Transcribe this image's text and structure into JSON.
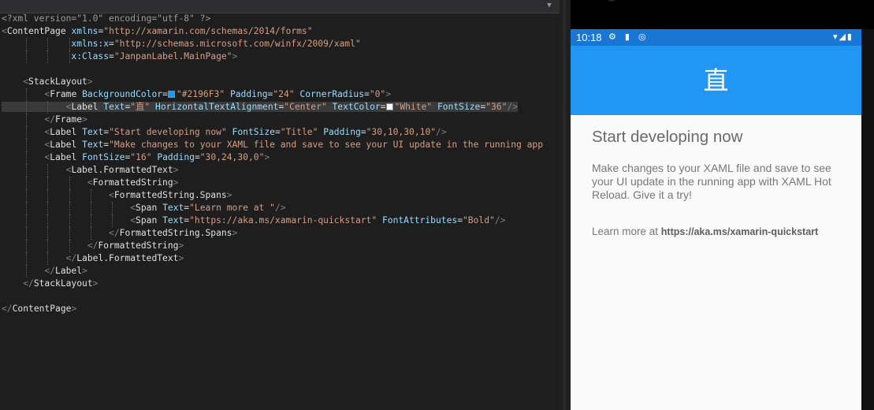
{
  "editor": {
    "lines": [
      {
        "indent": 0,
        "parts": [
          [
            "dec",
            "<?xml version=\"1.0\" encoding=\"utf-8\" ?>"
          ]
        ]
      },
      {
        "indent": 0,
        "parts": [
          [
            "br",
            "<"
          ],
          [
            "tagn",
            "ContentPage"
          ],
          [
            "t",
            " "
          ],
          [
            "attr",
            "xmlns"
          ],
          [
            "eq",
            "="
          ],
          [
            "val",
            "\"http://xamarin.com/schemas/2014/forms\""
          ]
        ]
      },
      {
        "indent": 0,
        "parts": [
          [
            "t",
            "             "
          ],
          [
            "attr",
            "xmlns:x"
          ],
          [
            "eq",
            "="
          ],
          [
            "val",
            "\"http://schemas.microsoft.com/winfx/2009/xaml\""
          ]
        ]
      },
      {
        "indent": 0,
        "parts": [
          [
            "t",
            "             "
          ],
          [
            "attr",
            "x:Class"
          ],
          [
            "eq",
            "="
          ],
          [
            "val",
            "\"JanpanLabel.MainPage\""
          ],
          [
            "br",
            ">"
          ]
        ]
      },
      {
        "indent": 0,
        "parts": []
      },
      {
        "indent": 0,
        "parts": [
          [
            "t",
            "    "
          ],
          [
            "br",
            "<"
          ],
          [
            "tagn",
            "StackLayout"
          ],
          [
            "br",
            ">"
          ]
        ]
      },
      {
        "indent": 0,
        "parts": [
          [
            "t",
            "        "
          ],
          [
            "br",
            "<"
          ],
          [
            "tagn",
            "Frame"
          ],
          [
            "t",
            " "
          ],
          [
            "attr",
            "BackgroundColor"
          ],
          [
            "eq",
            "="
          ],
          [
            "swatch",
            "#2196F3"
          ],
          [
            "val",
            "\"#2196F3\""
          ],
          [
            "t",
            " "
          ],
          [
            "attr",
            "Padding"
          ],
          [
            "eq",
            "="
          ],
          [
            "val",
            "\"24\""
          ],
          [
            "t",
            " "
          ],
          [
            "attr",
            "CornerRadius"
          ],
          [
            "eq",
            "="
          ],
          [
            "val",
            "\"0\""
          ],
          [
            "br",
            ">"
          ]
        ]
      },
      {
        "indent": 0,
        "highlight": true,
        "parts": [
          [
            "t",
            "            "
          ],
          [
            "br",
            "<"
          ],
          [
            "tagn",
            "Label"
          ],
          [
            "t",
            " "
          ],
          [
            "attr",
            "Text"
          ],
          [
            "eq",
            "="
          ],
          [
            "val",
            "\"直\""
          ],
          [
            "t",
            " "
          ],
          [
            "attr",
            "HorizontalTextAlignment"
          ],
          [
            "eq",
            "="
          ],
          [
            "val",
            "\"Center\""
          ],
          [
            "t",
            " "
          ],
          [
            "attr",
            "TextColor"
          ],
          [
            "eq",
            "="
          ],
          [
            "swatch",
            "#FFFFFF"
          ],
          [
            "val",
            "\"White\""
          ],
          [
            "t",
            " "
          ],
          [
            "attr",
            "FontSize"
          ],
          [
            "eq",
            "="
          ],
          [
            "val",
            "\"36\""
          ],
          [
            "br",
            "/>"
          ]
        ]
      },
      {
        "indent": 0,
        "parts": [
          [
            "t",
            "        "
          ],
          [
            "br",
            "</"
          ],
          [
            "tagn",
            "Frame"
          ],
          [
            "br",
            ">"
          ]
        ]
      },
      {
        "indent": 0,
        "parts": [
          [
            "t",
            "        "
          ],
          [
            "br",
            "<"
          ],
          [
            "tagn",
            "Label"
          ],
          [
            "t",
            " "
          ],
          [
            "attr",
            "Text"
          ],
          [
            "eq",
            "="
          ],
          [
            "val",
            "\"Start developing now\""
          ],
          [
            "t",
            " "
          ],
          [
            "attr",
            "FontSize"
          ],
          [
            "eq",
            "="
          ],
          [
            "val",
            "\"Title\""
          ],
          [
            "t",
            " "
          ],
          [
            "attr",
            "Padding"
          ],
          [
            "eq",
            "="
          ],
          [
            "val",
            "\"30,10,30,10\""
          ],
          [
            "br",
            "/>"
          ]
        ]
      },
      {
        "indent": 0,
        "parts": [
          [
            "t",
            "        "
          ],
          [
            "br",
            "<"
          ],
          [
            "tagn",
            "Label"
          ],
          [
            "t",
            " "
          ],
          [
            "attr",
            "Text"
          ],
          [
            "eq",
            "="
          ],
          [
            "val",
            "\"Make changes to your XAML file and save to see your UI update in the running app"
          ]
        ]
      },
      {
        "indent": 0,
        "parts": [
          [
            "t",
            "        "
          ],
          [
            "br",
            "<"
          ],
          [
            "tagn",
            "Label"
          ],
          [
            "t",
            " "
          ],
          [
            "attr",
            "FontSize"
          ],
          [
            "eq",
            "="
          ],
          [
            "val",
            "\"16\""
          ],
          [
            "t",
            " "
          ],
          [
            "attr",
            "Padding"
          ],
          [
            "eq",
            "="
          ],
          [
            "val",
            "\"30,24,30,0\""
          ],
          [
            "br",
            ">"
          ]
        ]
      },
      {
        "indent": 0,
        "parts": [
          [
            "t",
            "            "
          ],
          [
            "br",
            "<"
          ],
          [
            "tagn",
            "Label.FormattedText"
          ],
          [
            "br",
            ">"
          ]
        ]
      },
      {
        "indent": 0,
        "parts": [
          [
            "t",
            "                "
          ],
          [
            "br",
            "<"
          ],
          [
            "tagn",
            "FormattedString"
          ],
          [
            "br",
            ">"
          ]
        ]
      },
      {
        "indent": 0,
        "parts": [
          [
            "t",
            "                    "
          ],
          [
            "br",
            "<"
          ],
          [
            "tagn",
            "FormattedString.Spans"
          ],
          [
            "br",
            ">"
          ]
        ]
      },
      {
        "indent": 0,
        "parts": [
          [
            "t",
            "                        "
          ],
          [
            "br",
            "<"
          ],
          [
            "tagn",
            "Span"
          ],
          [
            "t",
            " "
          ],
          [
            "attr",
            "Text"
          ],
          [
            "eq",
            "="
          ],
          [
            "val",
            "\"Learn more at \""
          ],
          [
            "br",
            "/>"
          ]
        ]
      },
      {
        "indent": 0,
        "parts": [
          [
            "t",
            "                        "
          ],
          [
            "br",
            "<"
          ],
          [
            "tagn",
            "Span"
          ],
          [
            "t",
            " "
          ],
          [
            "attr",
            "Text"
          ],
          [
            "eq",
            "="
          ],
          [
            "val",
            "\"https://aka.ms/xamarin-quickstart\""
          ],
          [
            "t",
            " "
          ],
          [
            "attr",
            "FontAttributes"
          ],
          [
            "eq",
            "="
          ],
          [
            "val",
            "\"Bold\""
          ],
          [
            "br",
            "/>"
          ]
        ]
      },
      {
        "indent": 0,
        "parts": [
          [
            "t",
            "                    "
          ],
          [
            "br",
            "</"
          ],
          [
            "tagn",
            "FormattedString.Spans"
          ],
          [
            "br",
            ">"
          ]
        ]
      },
      {
        "indent": 0,
        "parts": [
          [
            "t",
            "                "
          ],
          [
            "br",
            "</"
          ],
          [
            "tagn",
            "FormattedString"
          ],
          [
            "br",
            ">"
          ]
        ]
      },
      {
        "indent": 0,
        "parts": [
          [
            "t",
            "            "
          ],
          [
            "br",
            "</"
          ],
          [
            "tagn",
            "Label.FormattedText"
          ],
          [
            "br",
            ">"
          ]
        ]
      },
      {
        "indent": 0,
        "parts": [
          [
            "t",
            "        "
          ],
          [
            "br",
            "</"
          ],
          [
            "tagn",
            "Label"
          ],
          [
            "br",
            ">"
          ]
        ]
      },
      {
        "indent": 0,
        "parts": [
          [
            "t",
            "    "
          ],
          [
            "br",
            "</"
          ],
          [
            "tagn",
            "StackLayout"
          ],
          [
            "br",
            ">"
          ]
        ]
      },
      {
        "indent": 0,
        "parts": []
      },
      {
        "indent": 0,
        "parts": [
          [
            "br",
            "</"
          ],
          [
            "tagn",
            "ContentPage"
          ],
          [
            "br",
            ">"
          ]
        ]
      }
    ]
  },
  "phone": {
    "status": {
      "time": "10:18",
      "left_icons": "⚙ ▮ ◎",
      "right_icons": "▾◢▮"
    },
    "header_text": "直",
    "title": "Start developing now",
    "body": "Make changes to your XAML file and save to see your UI update in the running app with XAML Hot Reload. Give it a try!",
    "link_prefix": "Learn more at ",
    "link_bold": "https://aka.ms/xamarin-quickstart"
  },
  "colors": {
    "header": "#2196f3",
    "statusbar": "#1976d2",
    "white": "#ffffff"
  }
}
